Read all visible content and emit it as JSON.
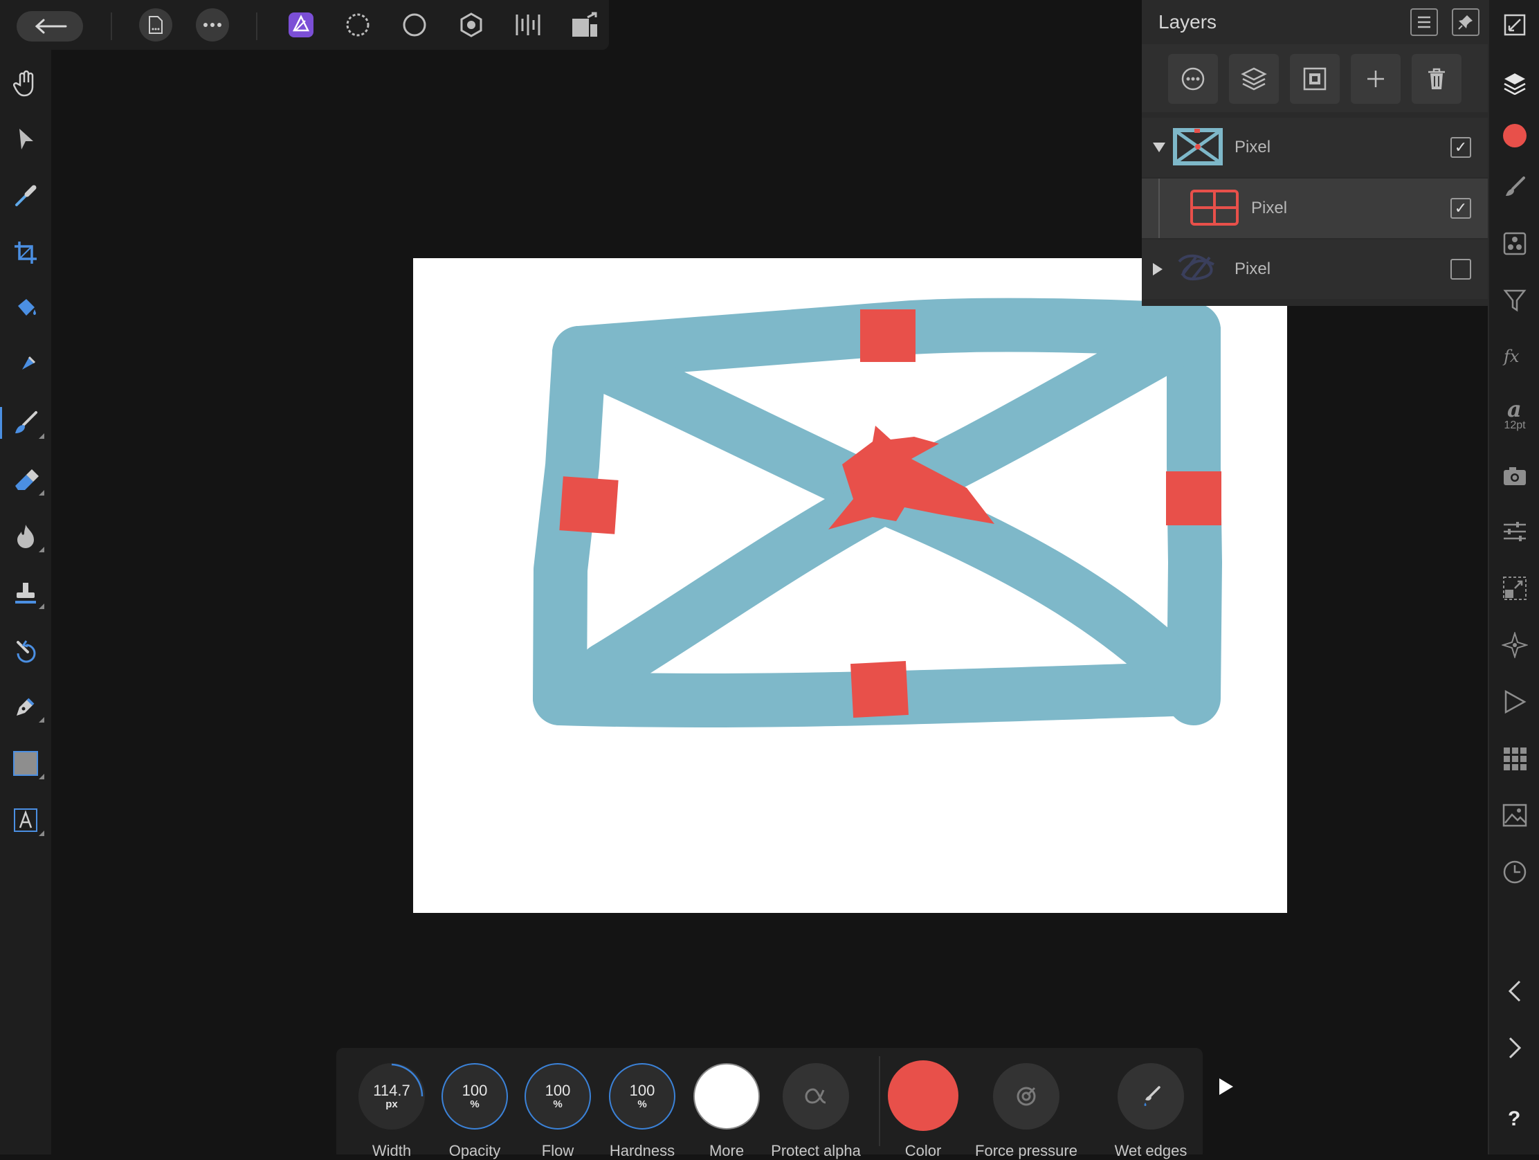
{
  "layers_panel": {
    "title": "Layers",
    "rows": [
      {
        "name": "Pixel",
        "checked": true,
        "expanded": true
      },
      {
        "name": "Pixel",
        "checked": true,
        "selected": true
      },
      {
        "name": "Pixel",
        "checked": false,
        "expanded": false
      }
    ]
  },
  "right_bar": {
    "text_size": "12pt",
    "color_swatch": "#e8504a"
  },
  "context_toolbar": {
    "width_value": "114.7",
    "width_unit": "px",
    "width_label": "Width",
    "opacity_value": "100",
    "opacity_unit": "%",
    "opacity_label": "Opacity",
    "flow_value": "100",
    "flow_unit": "%",
    "flow_label": "Flow",
    "hardness_value": "100",
    "hardness_unit": "%",
    "hardness_label": "Hardness",
    "more_label": "More",
    "protect_alpha_label": "Protect alpha",
    "color_label": "Color",
    "force_pressure_label": "Force pressure",
    "wet_edges_label": "Wet edges",
    "brush_color": "#e8504a"
  },
  "colors": {
    "accent": "#3b82d8",
    "stroke_blue": "#7eb8c9",
    "stroke_red": "#e8504a",
    "persona_purple": "#7b4fd6"
  }
}
